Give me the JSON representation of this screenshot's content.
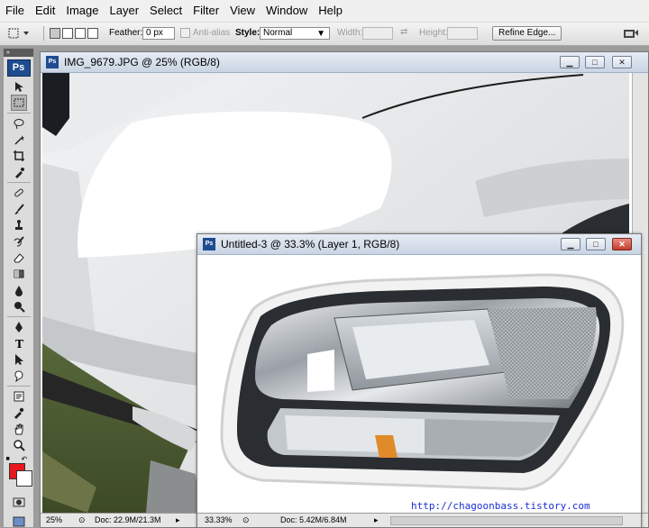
{
  "menu": [
    "File",
    "Edit",
    "Image",
    "Layer",
    "Select",
    "Filter",
    "View",
    "Window",
    "Help"
  ],
  "options": {
    "feather_label": "Feather:",
    "feather_value": "0 px",
    "antialias_label": "Anti-alias",
    "style_label": "Style:",
    "style_value": "Normal",
    "width_label": "Width:",
    "height_label": "Height:",
    "refine_label": "Refine Edge..."
  },
  "toolbox": {
    "logo": "Ps",
    "tools": [
      "move-tool-icon",
      "marquee-tool-icon",
      "lasso-tool-icon",
      "magic-wand-icon",
      "crop-tool-icon",
      "eyedropper-tool-icon",
      "healing-brush-icon",
      "brush-tool-icon",
      "clone-stamp-icon",
      "history-brush-icon",
      "eraser-tool-icon",
      "gradient-tool-icon",
      "blur-tool-icon",
      "dodge-tool-icon",
      "pen-tool-icon",
      "type-tool-icon",
      "path-selection-icon",
      "custom-shape-icon",
      "notes-tool-icon",
      "eyedropper-icon",
      "hand-tool-icon",
      "zoom-tool-icon"
    ],
    "foreground_color": "#e8171c",
    "background_color": "#ffffff"
  },
  "window1": {
    "title": "IMG_9679.JPG @ 25% (RGB/8)",
    "zoom": "25%",
    "doc": "Doc: 22.9M/21.3M"
  },
  "window2": {
    "title": "Untitled-3 @ 33.3% (Layer 1, RGB/8)",
    "zoom": "33.33%",
    "doc": "Doc: 5.42M/6.84M",
    "watermark": "http://chagoonbass.tistory.com"
  }
}
